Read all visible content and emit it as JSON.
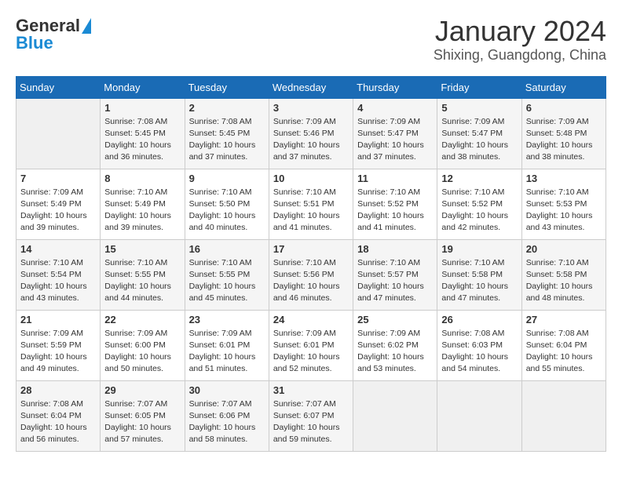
{
  "header": {
    "logo_general": "General",
    "logo_blue": "Blue",
    "title": "January 2024",
    "subtitle": "Shixing, Guangdong, China"
  },
  "calendar": {
    "days_of_week": [
      "Sunday",
      "Monday",
      "Tuesday",
      "Wednesday",
      "Thursday",
      "Friday",
      "Saturday"
    ],
    "weeks": [
      [
        {
          "day": "",
          "sunrise": "",
          "sunset": "",
          "daylight": "",
          "empty": true
        },
        {
          "day": "1",
          "sunrise": "7:08 AM",
          "sunset": "5:45 PM",
          "daylight": "10 hours and 36 minutes."
        },
        {
          "day": "2",
          "sunrise": "7:08 AM",
          "sunset": "5:45 PM",
          "daylight": "10 hours and 37 minutes."
        },
        {
          "day": "3",
          "sunrise": "7:09 AM",
          "sunset": "5:46 PM",
          "daylight": "10 hours and 37 minutes."
        },
        {
          "day": "4",
          "sunrise": "7:09 AM",
          "sunset": "5:47 PM",
          "daylight": "10 hours and 37 minutes."
        },
        {
          "day": "5",
          "sunrise": "7:09 AM",
          "sunset": "5:47 PM",
          "daylight": "10 hours and 38 minutes."
        },
        {
          "day": "6",
          "sunrise": "7:09 AM",
          "sunset": "5:48 PM",
          "daylight": "10 hours and 38 minutes."
        }
      ],
      [
        {
          "day": "7",
          "sunrise": "7:09 AM",
          "sunset": "5:49 PM",
          "daylight": "10 hours and 39 minutes."
        },
        {
          "day": "8",
          "sunrise": "7:10 AM",
          "sunset": "5:49 PM",
          "daylight": "10 hours and 39 minutes."
        },
        {
          "day": "9",
          "sunrise": "7:10 AM",
          "sunset": "5:50 PM",
          "daylight": "10 hours and 40 minutes."
        },
        {
          "day": "10",
          "sunrise": "7:10 AM",
          "sunset": "5:51 PM",
          "daylight": "10 hours and 41 minutes."
        },
        {
          "day": "11",
          "sunrise": "7:10 AM",
          "sunset": "5:52 PM",
          "daylight": "10 hours and 41 minutes."
        },
        {
          "day": "12",
          "sunrise": "7:10 AM",
          "sunset": "5:52 PM",
          "daylight": "10 hours and 42 minutes."
        },
        {
          "day": "13",
          "sunrise": "7:10 AM",
          "sunset": "5:53 PM",
          "daylight": "10 hours and 43 minutes."
        }
      ],
      [
        {
          "day": "14",
          "sunrise": "7:10 AM",
          "sunset": "5:54 PM",
          "daylight": "10 hours and 43 minutes."
        },
        {
          "day": "15",
          "sunrise": "7:10 AM",
          "sunset": "5:55 PM",
          "daylight": "10 hours and 44 minutes."
        },
        {
          "day": "16",
          "sunrise": "7:10 AM",
          "sunset": "5:55 PM",
          "daylight": "10 hours and 45 minutes."
        },
        {
          "day": "17",
          "sunrise": "7:10 AM",
          "sunset": "5:56 PM",
          "daylight": "10 hours and 46 minutes."
        },
        {
          "day": "18",
          "sunrise": "7:10 AM",
          "sunset": "5:57 PM",
          "daylight": "10 hours and 47 minutes."
        },
        {
          "day": "19",
          "sunrise": "7:10 AM",
          "sunset": "5:58 PM",
          "daylight": "10 hours and 47 minutes."
        },
        {
          "day": "20",
          "sunrise": "7:10 AM",
          "sunset": "5:58 PM",
          "daylight": "10 hours and 48 minutes."
        }
      ],
      [
        {
          "day": "21",
          "sunrise": "7:09 AM",
          "sunset": "5:59 PM",
          "daylight": "10 hours and 49 minutes."
        },
        {
          "day": "22",
          "sunrise": "7:09 AM",
          "sunset": "6:00 PM",
          "daylight": "10 hours and 50 minutes."
        },
        {
          "day": "23",
          "sunrise": "7:09 AM",
          "sunset": "6:01 PM",
          "daylight": "10 hours and 51 minutes."
        },
        {
          "day": "24",
          "sunrise": "7:09 AM",
          "sunset": "6:01 PM",
          "daylight": "10 hours and 52 minutes."
        },
        {
          "day": "25",
          "sunrise": "7:09 AM",
          "sunset": "6:02 PM",
          "daylight": "10 hours and 53 minutes."
        },
        {
          "day": "26",
          "sunrise": "7:08 AM",
          "sunset": "6:03 PM",
          "daylight": "10 hours and 54 minutes."
        },
        {
          "day": "27",
          "sunrise": "7:08 AM",
          "sunset": "6:04 PM",
          "daylight": "10 hours and 55 minutes."
        }
      ],
      [
        {
          "day": "28",
          "sunrise": "7:08 AM",
          "sunset": "6:04 PM",
          "daylight": "10 hours and 56 minutes."
        },
        {
          "day": "29",
          "sunrise": "7:07 AM",
          "sunset": "6:05 PM",
          "daylight": "10 hours and 57 minutes."
        },
        {
          "day": "30",
          "sunrise": "7:07 AM",
          "sunset": "6:06 PM",
          "daylight": "10 hours and 58 minutes."
        },
        {
          "day": "31",
          "sunrise": "7:07 AM",
          "sunset": "6:07 PM",
          "daylight": "10 hours and 59 minutes."
        },
        {
          "day": "",
          "sunrise": "",
          "sunset": "",
          "daylight": "",
          "empty": true
        },
        {
          "day": "",
          "sunrise": "",
          "sunset": "",
          "daylight": "",
          "empty": true
        },
        {
          "day": "",
          "sunrise": "",
          "sunset": "",
          "daylight": "",
          "empty": true
        }
      ]
    ]
  }
}
